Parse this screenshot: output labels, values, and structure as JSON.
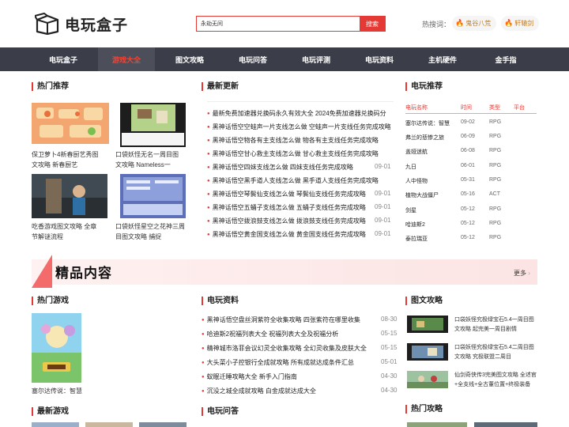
{
  "header": {
    "logo_text": "电玩盒子",
    "search_value": "永劫无间",
    "search_button": "搜索",
    "hot_label": "热搜词：",
    "hot_tags": [
      "鬼谷八荒",
      "轩辕剑"
    ]
  },
  "nav": {
    "items": [
      "电玩盒子",
      "游戏大全",
      "图文攻略",
      "电玩问答",
      "电玩评测",
      "电玩资料",
      "主机硬件",
      "金手指"
    ],
    "active_index": 1
  },
  "hot_recommend": {
    "title": "热门推荐",
    "items": [
      {
        "line1": "保卫萝卜4新春厨艺秀图",
        "line2": "文攻略 新春厨艺"
      },
      {
        "line1": "口袋妖怪无名一周目图",
        "line2": "文攻略 Nameless一"
      },
      {
        "line1": "吃香游戏图文攻略 全章",
        "line2": "节解谜流程"
      },
      {
        "line1": "口袋妖怪星空之花神三周",
        "line2": "目图文攻略 捕捉"
      }
    ]
  },
  "latest": {
    "title": "最新更新",
    "items": [
      {
        "text": "最新免费加速器兑换码永久有效大全 2024免费加速器兑换码分",
        "date": ""
      },
      {
        "text": "黑神话悟空空蛙声一片支线怎么做 空蛙声一片支线任务完成攻略",
        "date": ""
      },
      {
        "text": "黑神话悟空物各有主支线怎么做 物各有主支线任务完成攻略",
        "date": "09-"
      },
      {
        "text": "黑神话悟空甘心救主支线怎么做 甘心救主支线任务完成攻略",
        "date": "09-"
      },
      {
        "text": "黑神话悟空四妹支线怎么做 四妹支线任务完成攻略",
        "date": "09-01"
      },
      {
        "text": "黑神话悟空黑手道人支线怎么做 黑手道人支线任务完成攻略",
        "date": "09-"
      },
      {
        "text": "黑神话悟空琴鬓仙支线怎么做 琴鬓仙支线任务完成攻略",
        "date": "09-01"
      },
      {
        "text": "黑神话悟空五蛹子支线怎么做 五蛹子支线任务完成攻略",
        "date": "09-01"
      },
      {
        "text": "黑神话悟空拨浪鼓支线怎么做 拨浪鼓支线任务完成攻略",
        "date": "09-01"
      },
      {
        "text": "黑神话悟空黄金国支线怎么做 黄金国支线任务完成攻略",
        "date": "09-01"
      }
    ]
  },
  "game_recommend": {
    "title": "电玩推荐",
    "headers": [
      "电玩名称",
      "时间",
      "类型",
      "平台"
    ],
    "rows": [
      [
        "塞尔达传说：智慧",
        "09-02",
        "RPG"
      ],
      [
        "弗兰的悲惨之旅",
        "06-09",
        "RPG"
      ],
      [
        "盖娅迷航",
        "06-08",
        "RPG"
      ],
      [
        "九日",
        "06-01",
        "RPG"
      ],
      [
        "人中怪物",
        "05-31",
        "RPG"
      ],
      [
        "植物大战僵尸",
        "05-16",
        "ACT"
      ],
      [
        "剑星",
        "05-12",
        "RPG"
      ],
      [
        "哈迪斯2",
        "05-12",
        "RPG"
      ],
      [
        "泰拉瑞亚",
        "05-12",
        "RPG"
      ]
    ]
  },
  "banner": {
    "title": "精品内容",
    "more": "更多"
  },
  "hot_games": {
    "title": "热门游戏",
    "caption": "塞尔达传说：智慧"
  },
  "game_info": {
    "title": "电玩资料",
    "items": [
      {
        "text": "黑神话悟空盘丝洞紫符全收集攻略 四张紫符在哪里收集",
        "date": "08-30"
      },
      {
        "text": "哈迪斯2祝福列表大全 祝福列表大全及祝福分析",
        "date": "05-15"
      },
      {
        "text": "精神城市洛菲会议幻灵全收集攻略 全幻灵收集及皮肤大全",
        "date": "05-15"
      },
      {
        "text": "大头菜小子控银行全成就攻略 所有成就达成条件汇总",
        "date": "05-01"
      },
      {
        "text": "蚁眠迁睡攻略大全 新手入门指南",
        "date": "04-30"
      },
      {
        "text": "沉没之城全成就攻略 白金成就达成大全",
        "date": "04-30"
      }
    ]
  },
  "guides": {
    "title": "图文攻略",
    "items": [
      {
        "line1": "口袋妖怪究极绿宝石5.4一周目图",
        "line2": "文攻略 起完美一周目剧情"
      },
      {
        "line1": "口袋妖怪究极绿宝石5.4二周目图",
        "line2": "文攻略 究极联盟二周目"
      },
      {
        "line1": "仙剑奇侠传3完美图文攻略 全述官",
        "line2": "+全支线+全古董位置+终极装备"
      }
    ]
  },
  "new_games": {
    "title": "最新游戏"
  },
  "qa": {
    "title": "电玩问答"
  },
  "hot_guides": {
    "title": "热门攻略"
  },
  "colors": {
    "accent": "#e53935",
    "nav_bg": "#3b3e48"
  }
}
